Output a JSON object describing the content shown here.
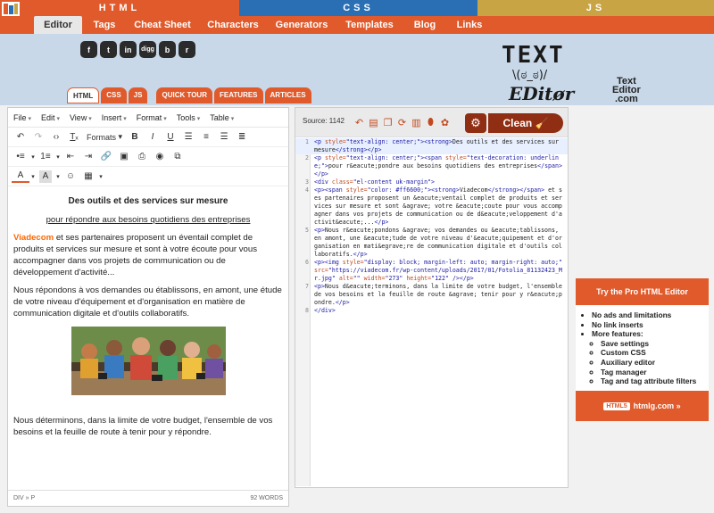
{
  "langbar": {
    "html": "HTML",
    "css": "CSS",
    "js": "JS"
  },
  "nav": {
    "items": [
      {
        "label": "Editor",
        "active": true
      },
      {
        "label": "Tags"
      },
      {
        "label": "Cheat Sheet"
      },
      {
        "label": "Characters"
      },
      {
        "label": "Generators"
      },
      {
        "label": "Templates"
      },
      {
        "label": "Blog"
      },
      {
        "label": "Links"
      }
    ]
  },
  "social": [
    "f",
    "t",
    "in",
    "digg",
    "b",
    "r"
  ],
  "brand": {
    "line1": "TEXT",
    "face": "\\(ಠ_ಠ)/",
    "line2": "EDitør",
    "sub1": "Text",
    "sub2": "Editor",
    "sub3": ".com"
  },
  "subtabs": [
    "HTML",
    "CSS",
    "JS",
    "QUICK TOUR",
    "FEATURES",
    "ARTICLES"
  ],
  "editor": {
    "menus": [
      "File",
      "Edit",
      "View",
      "Insert",
      "Format",
      "Tools",
      "Table"
    ],
    "formats_label": "Formats",
    "heading": "Des outils et des services sur mesure",
    "subheading": "pour répondre aux besoins quotidiens des entreprises",
    "brand_word": "Viadecom",
    "para1": " et ses partenaires proposent un éventail complet de produits et services sur mesure et sont à votre écoute pour vous accompagner dans vos projets de communication ou de développement d'activité...",
    "para2": "Nous répondons à vos demandes ou établissons, en amont, une étude de votre niveau d'équipement et d'organisation en matière de communication digitale et d'outils collaboratifs.",
    "para3": "Nous déterminons, dans la limite de votre budget, l'ensemble de vos besoins et la feuille de route à tenir pour y répondre.",
    "path": "DIV » P",
    "words": "92 WORDS"
  },
  "codepanel": {
    "source_label": "Source: 1142",
    "clean_label": "Clean"
  },
  "promo": {
    "title": "Try the Pro HTML Editor",
    "items": [
      "No ads and limitations",
      "No link inserts",
      "More features:"
    ],
    "subitems": [
      "Save settings",
      "Custom CSS",
      "Auxiliary editor",
      "Tag manager",
      "Tag and tag attribute filters"
    ],
    "footer": "htmlg.com »",
    "footer_badge": "HTML5"
  },
  "colors": {
    "orange": "#e05a2b",
    "blue": "#2a6fb4",
    "gold": "#c9a445",
    "dark_red": "#8f2e13",
    "brand_orange": "#ff6600"
  }
}
